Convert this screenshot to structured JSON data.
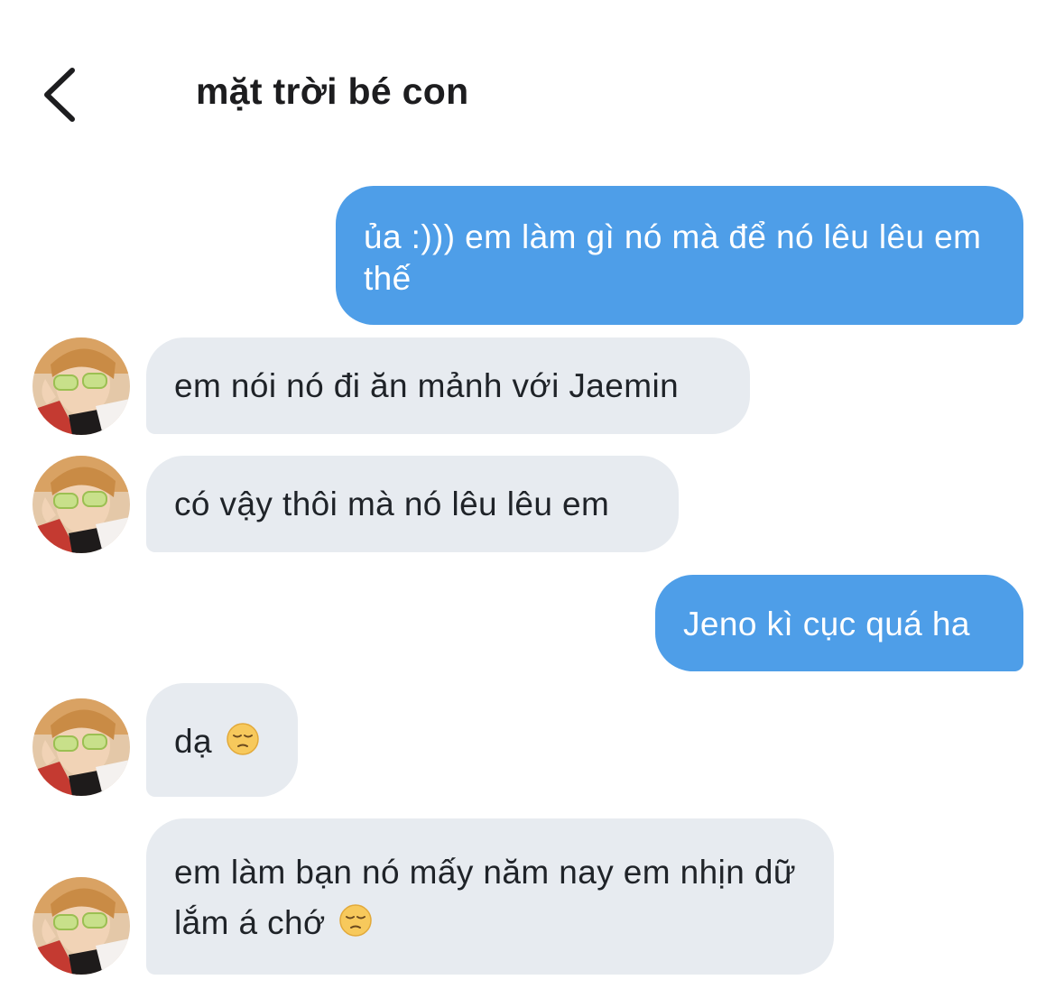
{
  "header": {
    "title": "mặt trời bé con"
  },
  "messages": [
    {
      "sender": "me",
      "text": "ủa :))) em làm gì nó mà để nó lêu lêu em thế"
    },
    {
      "sender": "contact",
      "text": "em nói nó đi ăn mảnh với Jaemin"
    },
    {
      "sender": "contact",
      "text": "có vậy thôi mà nó lêu lêu em"
    },
    {
      "sender": "me",
      "text": "Jeno kì cục quá ha"
    },
    {
      "sender": "contact",
      "text": "dạ",
      "emoji": "pensive-face"
    },
    {
      "sender": "contact",
      "text": "em làm bạn nó mấy năm nay em nhịn dữ lắm á chớ",
      "emoji": "pensive-face"
    }
  ],
  "colors": {
    "outgoing_bubble": "#4e9ee8",
    "incoming_bubble": "#e7ebf0",
    "title_text": "#1d1d1f"
  }
}
